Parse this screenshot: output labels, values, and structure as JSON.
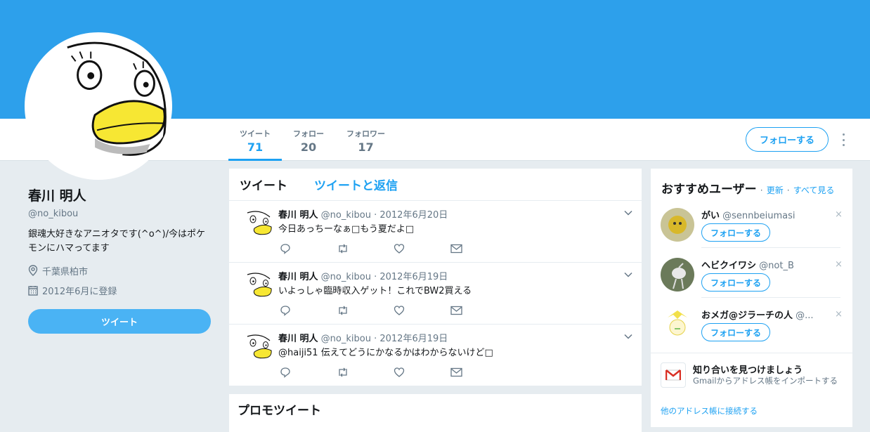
{
  "profile": {
    "name": "春川 明人",
    "handle": "@no_kibou",
    "bio": "銀魂大好きなアニオタです(^o^)/今はポケモンにハマってます",
    "location": "千葉県柏市",
    "joined": "2012年6月に登録",
    "tweet_button": "ツイート"
  },
  "stats": [
    {
      "label": "ツイート",
      "value": "71"
    },
    {
      "label": "フォロー",
      "value": "20"
    },
    {
      "label": "フォロワー",
      "value": "17"
    }
  ],
  "header": {
    "follow_button": "フォローする"
  },
  "timeline": {
    "tabs": [
      "ツイート",
      "ツイートと返信"
    ],
    "tweets": [
      {
        "name": "春川 明人",
        "handle": "@no_kibou",
        "date": "· 2012年6月20日",
        "text": "今日あっちーなぁ□もう夏だよ□"
      },
      {
        "name": "春川 明人",
        "handle": "@no_kibou",
        "date": "· 2012年6月19日",
        "text": "いよっしゃ臨時収入ゲット！これでBW2買える"
      },
      {
        "name": "春川 明人",
        "handle": "@no_kibou",
        "date": "· 2012年6月19日",
        "text": "@haiji51 伝えてどうにかなるかはわからないけど□"
      }
    ],
    "promo_title": "プロモツイート"
  },
  "sidebar": {
    "title": "おすすめユーザー",
    "sep": "·",
    "refresh": "更新",
    "see_all": "すべて見る",
    "recommendations": [
      {
        "name": "がい",
        "handle": "@sennbeiumasi",
        "button": "フォローする",
        "close": "×"
      },
      {
        "name": "ヘビクイワシ",
        "handle": "@not_B",
        "button": "フォローする",
        "close": "×"
      },
      {
        "name": "おメガ@ジラーチの人",
        "handle": "@...",
        "button": "フォローする",
        "close": "×"
      }
    ],
    "find_title": "知り合いを見つけましょう",
    "find_sub": "Gmailからアドレス帳をインポートする",
    "other_link": "他のアドレス帳に接続する"
  },
  "colors": {
    "banner": "#2da0eb",
    "accent": "#1da1f2",
    "tweet_button": "#4ab3f4"
  }
}
